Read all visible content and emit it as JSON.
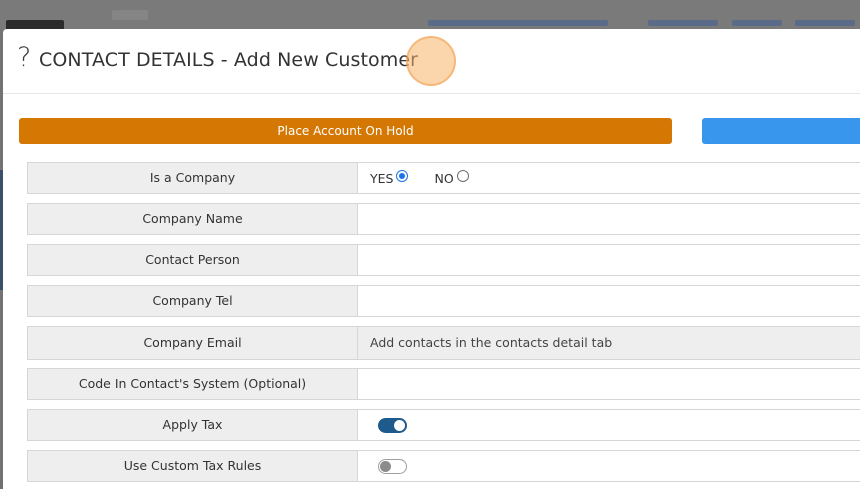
{
  "modal": {
    "help_icon": "?",
    "title": "CONTACT DETAILS - Add New Customer"
  },
  "actions": {
    "hold_label": "Place Account On Hold",
    "hold_color": "#d47803",
    "secondary_label": "",
    "secondary_color": "#3897ec"
  },
  "form": {
    "is_company": {
      "label": "Is a Company",
      "options": [
        {
          "label": "YES",
          "selected": true
        },
        {
          "label": "NO",
          "selected": false
        }
      ]
    },
    "company_name": {
      "label": "Company Name",
      "value": ""
    },
    "contact_person": {
      "label": "Contact Person",
      "value": ""
    },
    "company_tel": {
      "label": "Company Tel",
      "value": ""
    },
    "company_email": {
      "label": "Company Email",
      "note": "Add contacts in the contacts detail tab"
    },
    "contact_code": {
      "label": "Code In Contact's System (Optional)",
      "value": ""
    },
    "apply_tax": {
      "label": "Apply Tax",
      "enabled": true
    },
    "custom_tax_rules": {
      "label": "Use Custom Tax Rules",
      "enabled": false
    }
  },
  "colors": {
    "toggle_on": "#1e5a8c",
    "radio_selected": "#1a73e8"
  }
}
